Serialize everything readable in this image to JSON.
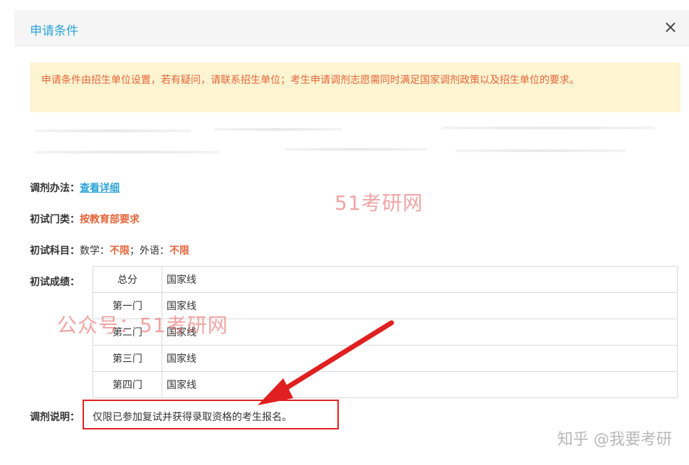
{
  "modal": {
    "title": "申请条件",
    "close_label": "×"
  },
  "notice": {
    "text": "申请条件由招生单位设置，若有疑问，请联系招生单位；考生申请调剂志愿需同时满足国家调剂政策以及招生单位的要求。"
  },
  "fields": {
    "method_label": "调剂办法：",
    "method_link": "查看详细",
    "category_label": "初试门类：",
    "category_value": "按教育部要求",
    "subjects_label": "初试科目：",
    "subjects_math_label": "数学：",
    "subjects_math_value": "不限",
    "subjects_sep": "；外语：",
    "subjects_lang_value": "不限",
    "scores_label": "初试成绩：",
    "scores": [
      {
        "name": "总分",
        "value": "国家线"
      },
      {
        "name": "第一门",
        "value": "国家线"
      },
      {
        "name": "第二门",
        "value": "国家线"
      },
      {
        "name": "第三门",
        "value": "国家线"
      },
      {
        "name": "第四门",
        "value": "国家线"
      }
    ],
    "explain_label": "调剂说明：",
    "explain_value": "仅限已参加复试并获得录取资格的考生报名。"
  },
  "watermarks": {
    "top": "51考研网",
    "middle": "公众号：51考研网",
    "zhihu": "知乎 @我要考研"
  },
  "colors": {
    "title_blue": "#2ba4d6",
    "notice_bg": "#fdf4d1",
    "accent_orange": "#e4663a",
    "annotation_red": "#e02020"
  }
}
